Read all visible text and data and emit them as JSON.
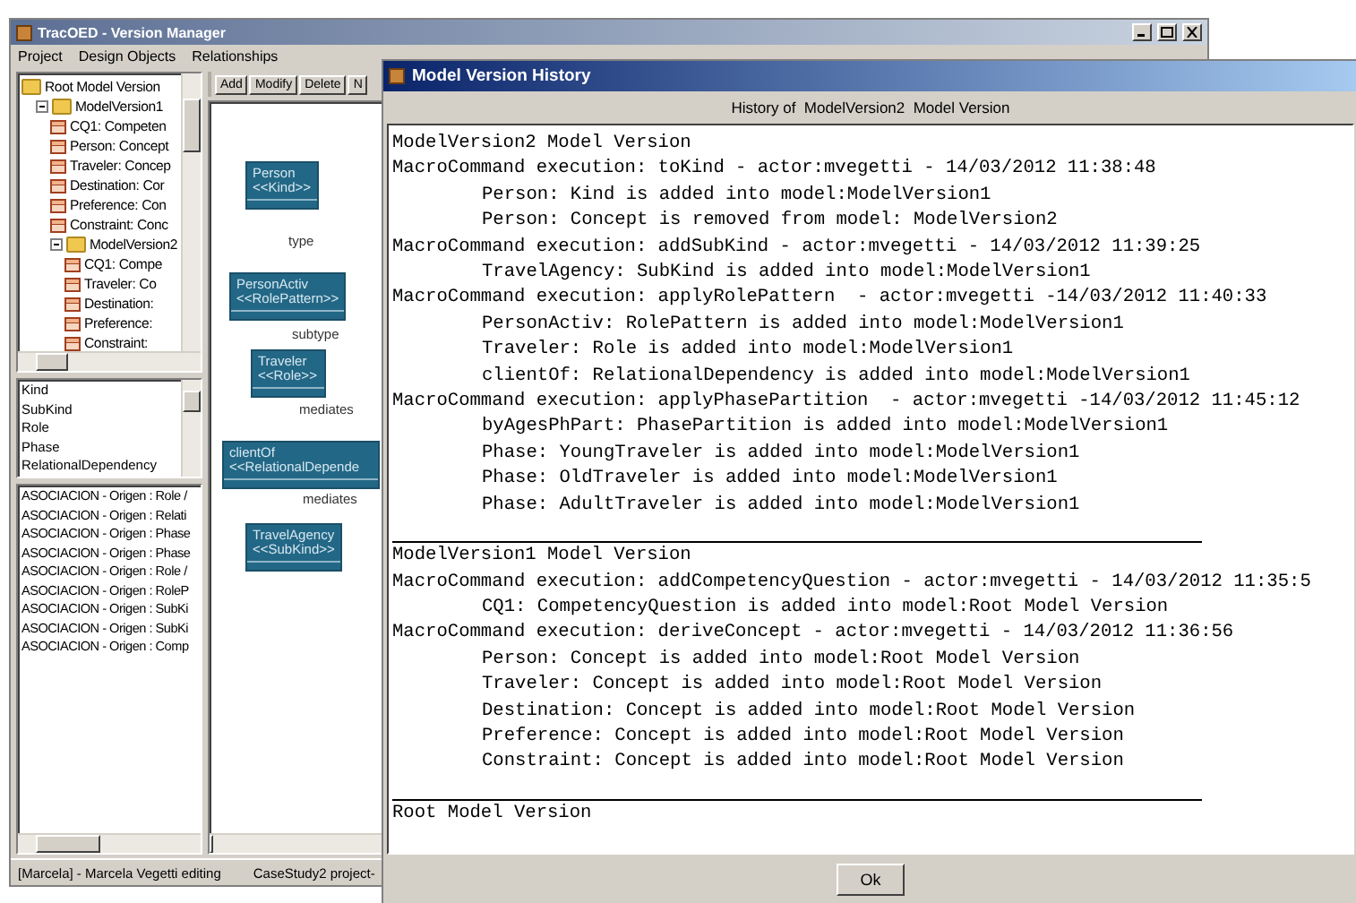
{
  "main_window": {
    "title": "TracOED - Version Manager",
    "menu": [
      "Project",
      "Design Objects",
      "Relationships"
    ],
    "tree": [
      {
        "label": "Root Model Version",
        "kind": "folder",
        "children": [
          {
            "label": "ModelVersion1",
            "kind": "folder",
            "expanded": true,
            "children": [
              {
                "label": "CQ1: Competen",
                "kind": "concept"
              },
              {
                "label": "Person: Concept",
                "kind": "concept"
              },
              {
                "label": "Traveler: Concep",
                "kind": "concept"
              },
              {
                "label": "Destination: Cor",
                "kind": "concept"
              },
              {
                "label": "Preference: Con",
                "kind": "concept"
              },
              {
                "label": "Constraint: Conc",
                "kind": "concept"
              },
              {
                "label": "ModelVersion2",
                "kind": "folder",
                "expanded": true,
                "children": [
                  {
                    "label": "CQ1: Compe",
                    "kind": "concept"
                  },
                  {
                    "label": "Traveler: Co",
                    "kind": "concept"
                  },
                  {
                    "label": "Destination:",
                    "kind": "concept"
                  },
                  {
                    "label": "Preference:",
                    "kind": "concept"
                  },
                  {
                    "label": "Constraint:",
                    "kind": "concept"
                  }
                ]
              }
            ]
          }
        ]
      }
    ],
    "type_list": [
      "Kind",
      "SubKind",
      "Role",
      "Phase",
      "RelationalDependency"
    ],
    "association_list": [
      "ASOCIACION - Origen : Role /",
      "ASOCIACION - Origen : Relati",
      "ASOCIACION - Origen : Phase",
      "ASOCIACION - Origen : Phase",
      "ASOCIACION - Origen : Role /",
      "ASOCIACION - Origen : RoleP",
      "ASOCIACION - Origen : SubKi",
      "ASOCIACION - Origen : SubKi",
      "ASOCIACION - Origen : Comp"
    ],
    "toolbar": [
      "Add",
      "Modify",
      "Delete",
      "N"
    ],
    "diagram": {
      "nodes": [
        {
          "name": "Person",
          "stereotype": "<<Kind>>"
        },
        {
          "name": "PersonActiv",
          "stereotype": "<<RolePattern>>"
        },
        {
          "name": "Traveler",
          "stereotype": "<<Role>>"
        },
        {
          "name": "clientOf",
          "stereotype": "<<RelationalDepende"
        },
        {
          "name": "TravelAgency",
          "stereotype": "<<SubKind>>"
        }
      ],
      "edges": [
        "type",
        "subtype",
        "mediates",
        "mediates"
      ]
    },
    "status_bar": [
      "[Marcela] - Marcela Vegetti editing",
      "CaseStudy2 project-"
    ]
  },
  "dialog": {
    "title": "Model Version History",
    "header": "History of  ModelVersion2  Model Version",
    "sections": [
      {
        "heading": "ModelVersion2 Model Version",
        "commands": [
          {
            "text": "MacroCommand execution: toKind - actor:mvegetti - 14/03/2012 11:38:48",
            "items": [
              "Person: Kind is added into model:ModelVersion1",
              "Person: Concept is removed from model: ModelVersion2"
            ]
          },
          {
            "text": "MacroCommand execution: addSubKind - actor:mvegetti - 14/03/2012 11:39:25",
            "items": [
              "TravelAgency: SubKind is added into model:ModelVersion1"
            ]
          },
          {
            "text": "MacroCommand execution: applyRolePattern  - actor:mvegetti -14/03/2012 11:40:33",
            "items": [
              "PersonActiv: RolePattern is added into model:ModelVersion1",
              "Traveler: Role is added into model:ModelVersion1",
              "clientOf: RelationalDependency is added into model:ModelVersion1"
            ]
          },
          {
            "text": "MacroCommand execution: applyPhasePartition  - actor:mvegetti -14/03/2012 11:45:12",
            "items": [
              "byAgesPhPart: PhasePartition is added into model:ModelVersion1",
              "Phase: YoungTraveler is added into model:ModelVersion1",
              "Phase: OldTraveler is added into model:ModelVersion1",
              "Phase: AdultTraveler is added into model:ModelVersion1"
            ]
          }
        ]
      },
      {
        "heading": "ModelVersion1 Model Version",
        "commands": [
          {
            "text": "MacroCommand execution: addCompetencyQuestion - actor:mvegetti - 14/03/2012 11:35:5",
            "items": [
              "CQ1: CompetencyQuestion is added into model:Root Model Version"
            ]
          },
          {
            "text": "MacroCommand execution: deriveConcept - actor:mvegetti - 14/03/2012 11:36:56",
            "items": [
              "Person: Concept is added into model:Root Model Version",
              "Traveler: Concept is added into model:Root Model Version",
              "Destination: Concept is added into model:Root Model Version",
              "Preference: Concept is added into model:Root Model Version",
              "Constraint: Concept is added into model:Root Model Version"
            ]
          }
        ]
      },
      {
        "heading": "Root Model Version"
      }
    ],
    "button": "Ok"
  }
}
